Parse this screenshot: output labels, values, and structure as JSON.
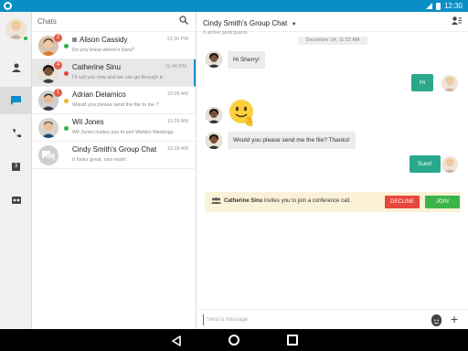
{
  "status_bar": {
    "time": "12:30"
  },
  "rail": {
    "items": [
      {
        "icon": "person-icon"
      },
      {
        "icon": "chat-bubble-icon",
        "active": true
      },
      {
        "icon": "phone-icon"
      },
      {
        "icon": "calendar-icon",
        "label": "3"
      },
      {
        "icon": "voicemail-icon"
      }
    ]
  },
  "list": {
    "header": "Chats",
    "rows": [
      {
        "name": "Alison Cassidy",
        "preview": "Do you know where's Sara?",
        "time": "12:30 PM",
        "badge": "2",
        "presence": "#2db34a",
        "locked": true
      },
      {
        "name": "Catherine Sinu",
        "preview": "I'll call you now and we can go through it.",
        "time": "11:46 PM",
        "badge": "4",
        "presence": "#e8453c",
        "selected": true
      },
      {
        "name": "Adrian Delamico",
        "preview": "Would you please send the file to me ?",
        "time": "10:28 AM",
        "badge": "1",
        "presence": "#f2b233"
      },
      {
        "name": "Wil Jones",
        "preview": "Wil Jones invites you to join WebEx Meetings.",
        "time": "10:28 AM",
        "badge": "",
        "presence": "#2db34a"
      },
      {
        "name": "Cindy Smith's Group Chat",
        "preview": "It looks great, nice work!",
        "time": "10:28 AM",
        "badge": "",
        "presence": ""
      }
    ]
  },
  "conversation": {
    "title": "Cindy Smith's Group Chat",
    "subtitle": "3 active participants",
    "date": "December 24, 11:22 AM",
    "messages": {
      "m1": "Hi Sherry!",
      "m2": "Hi",
      "m4": "Would you please send me the file? Thanks!",
      "m5": "Sure!"
    },
    "invite": {
      "name": "Catherine Sinu",
      "text": "invites you to join a conference call.",
      "decline": "DECLINE",
      "join": "JOIN"
    },
    "composer_placeholder": "Send a message"
  },
  "colors": {
    "accent": "#0a8ec6",
    "outgoing": "#2aa88c",
    "decline": "#e8453c",
    "join": "#3cb44a"
  }
}
